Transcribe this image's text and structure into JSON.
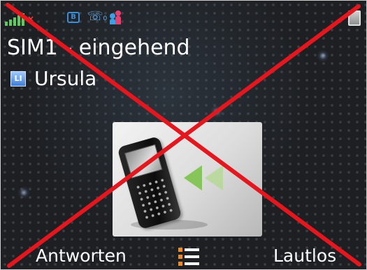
{
  "status_bar": {
    "signal_icon": "signal-strength-icon",
    "no_data_icon": "no-connection-x-icon",
    "sim_icon": "sim-card-icon",
    "missed_call_icon": "missed-call-icon",
    "contacts_icon": "contacts-icon",
    "battery_icon": "battery-icon",
    "signal_x_glyph": "×",
    "sim_glyph": "B",
    "call_glyph": "☏",
    "call_sub_glyph": "0"
  },
  "call": {
    "title": "SIM1 - eingehend",
    "contact_icon_glyph": "LI",
    "caller_name": "Ursula"
  },
  "softkeys": {
    "left_label": "Antworten",
    "right_label": "Lautlos",
    "menu_icon": "menu-list-icon"
  },
  "colors": {
    "background": "#1d1f22",
    "text": "#ffffff",
    "cross": "#e5161e",
    "menu_accent": "#f28a1e",
    "signal": "#5fc85f"
  }
}
